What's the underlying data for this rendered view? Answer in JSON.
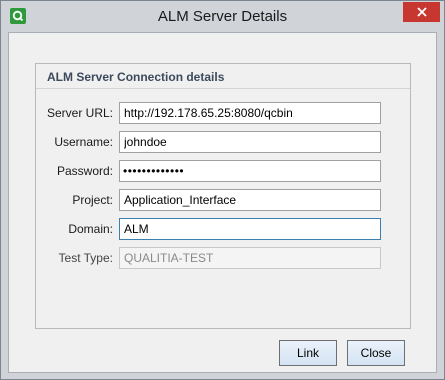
{
  "window": {
    "title": "ALM Server Details",
    "close_glyph": "✕"
  },
  "group": {
    "title": "ALM Server Connection details"
  },
  "form": {
    "server_url": {
      "label": "Server URL:",
      "value": "http://192.178.65.25:8080/qcbin"
    },
    "username": {
      "label": "Username:",
      "value": "johndoe"
    },
    "password": {
      "label": "Password:",
      "value": "•••••••••••••"
    },
    "project": {
      "label": "Project:",
      "value": "Application_Interface"
    },
    "domain": {
      "label": "Domain:",
      "value": "ALM"
    },
    "test_type": {
      "label": "Test Type:",
      "value": "QUALITIA-TEST"
    }
  },
  "buttons": {
    "link": "Link",
    "close": "Close"
  },
  "colors": {
    "close_button": "#c7372f",
    "app_icon": "#2e9a3c",
    "focus_border": "#3c7fb1"
  },
  "icons": {
    "app": "qualitia-app-icon",
    "close": "close-icon"
  }
}
